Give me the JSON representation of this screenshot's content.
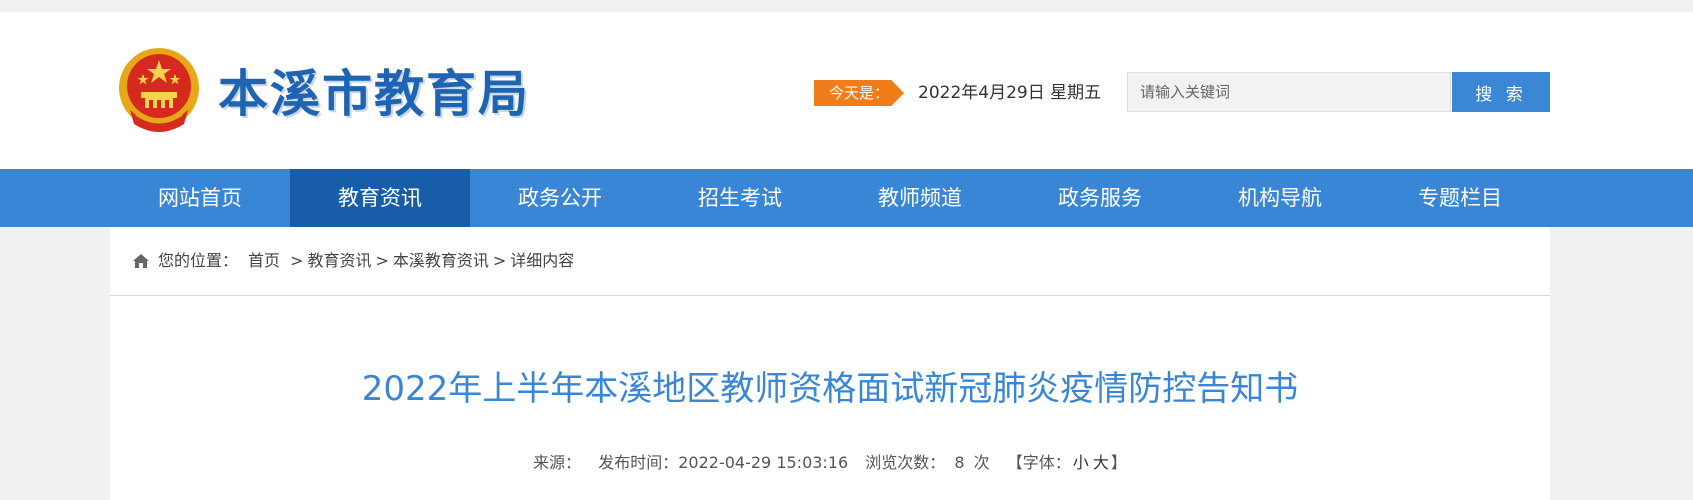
{
  "header": {
    "site_title": "本溪市教育局",
    "today_label": "今天是：",
    "today_date": "2022年4月29日  星期五",
    "search_placeholder": "请输入关键词",
    "search_button": "搜 索"
  },
  "nav": {
    "items": [
      "网站首页",
      "教育资讯",
      "政务公开",
      "招生考试",
      "教师频道",
      "政务服务",
      "机构导航",
      "专题栏目"
    ],
    "active_index": 1
  },
  "breadcrumb": {
    "prefix": "您的位置：",
    "items": [
      "首页",
      "教育资讯",
      "本溪教育资讯",
      "详细内容"
    ],
    "separator": ">"
  },
  "article": {
    "title": "2022年上半年本溪地区教师资格面试新冠肺炎疫情防控告知书",
    "source_label": "来源：",
    "publish_label": "发布时间：2022-04-29 15:03:16",
    "views_label": "浏览次数：",
    "views_count": "8",
    "views_unit": "次",
    "font_prefix": "【字体：",
    "font_small": "小",
    "font_large": "大",
    "font_suffix": "】"
  },
  "colors": {
    "primary_blue": "#3a86d6",
    "active_nav": "#175da8",
    "title_blue": "#1f63b3",
    "accent_orange": "#f07c1a"
  },
  "icons": {
    "emblem": "national-emblem-icon",
    "home": "home-icon"
  }
}
